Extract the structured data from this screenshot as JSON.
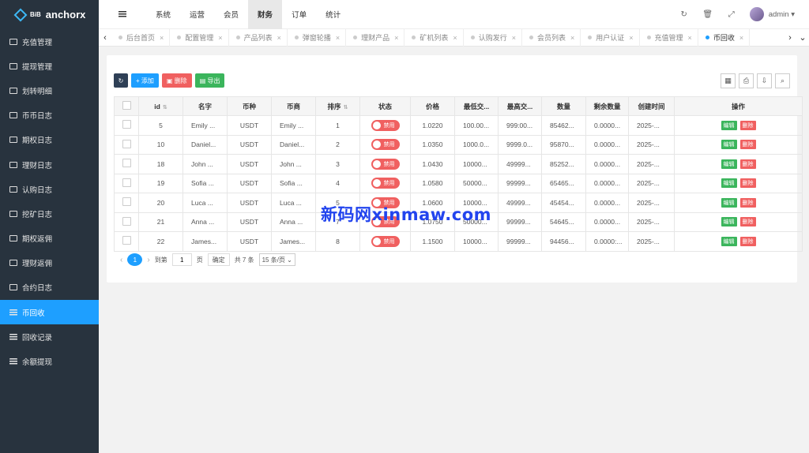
{
  "brand": {
    "badge": "BiB",
    "name": "anchorx"
  },
  "sidebar": {
    "items": [
      {
        "label": "充值管理",
        "icon": "card-icon"
      },
      {
        "label": "提现管理",
        "icon": "card-icon"
      },
      {
        "label": "划转明细",
        "icon": "card-icon"
      },
      {
        "label": "币币日志",
        "icon": "card-icon"
      },
      {
        "label": "期权日志",
        "icon": "card-icon"
      },
      {
        "label": "理财日志",
        "icon": "card-icon"
      },
      {
        "label": "认购日志",
        "icon": "card-icon"
      },
      {
        "label": "挖矿日志",
        "icon": "card-icon"
      },
      {
        "label": "期权返佣",
        "icon": "card-icon"
      },
      {
        "label": "理财返佣",
        "icon": "card-icon"
      },
      {
        "label": "合约日志",
        "icon": "card-icon"
      },
      {
        "label": "币回收",
        "icon": "list-icon",
        "active": true
      },
      {
        "label": "回收记录",
        "icon": "list-icon"
      },
      {
        "label": "余额提现",
        "icon": "list-icon"
      }
    ]
  },
  "topnav": {
    "items": [
      "系统",
      "运营",
      "会员",
      "财务",
      "订单",
      "统计"
    ],
    "active": "财务"
  },
  "header": {
    "user": "admin ▾"
  },
  "tabs": {
    "items": [
      "后台首页",
      "配置管理",
      "产品列表",
      "弹窗轮播",
      "理财产品",
      "矿机列表",
      "认购发行",
      "会员列表",
      "用户认证",
      "充值管理",
      "币回收"
    ],
    "active": "币回收"
  },
  "toolbar": {
    "add": "+ 添加",
    "delete": "删除",
    "export": "导出"
  },
  "table": {
    "headers": [
      "id",
      "名字",
      "币种",
      "币商",
      "排序",
      "状态",
      "价格",
      "最低交...",
      "最高交...",
      "数量",
      "剩余数量",
      "创建时间",
      "操作"
    ],
    "status_label": "禁用",
    "edit_label": "编辑",
    "delete_label": "删除",
    "rows": [
      {
        "id": "5",
        "name": "Emily ...",
        "coin": "USDT",
        "merchant": "Emily ...",
        "sort": "1",
        "price": "1.0220",
        "min": "100.00...",
        "max": "999:00...",
        "qty": "85462...",
        "remain": "0.0000...",
        "created": "2025-..."
      },
      {
        "id": "10",
        "name": "Daniel...",
        "coin": "USDT",
        "merchant": "Daniel...",
        "sort": "2",
        "price": "1.0350",
        "min": "1000.0...",
        "max": "9999.0...",
        "qty": "95870...",
        "remain": "0.0000...",
        "created": "2025-..."
      },
      {
        "id": "18",
        "name": "John ...",
        "coin": "USDT",
        "merchant": "John ...",
        "sort": "3",
        "price": "1.0430",
        "min": "10000...",
        "max": "49999...",
        "qty": "85252...",
        "remain": "0.0000...",
        "created": "2025-..."
      },
      {
        "id": "19",
        "name": "Sofia ...",
        "coin": "USDT",
        "merchant": "Sofia ...",
        "sort": "4",
        "price": "1.0580",
        "min": "50000...",
        "max": "99999...",
        "qty": "65465...",
        "remain": "0.0000...",
        "created": "2025-..."
      },
      {
        "id": "20",
        "name": "Luca ...",
        "coin": "USDT",
        "merchant": "Luca ...",
        "sort": "5",
        "price": "1.0600",
        "min": "10000...",
        "max": "49999...",
        "qty": "45454...",
        "remain": "0.0000...",
        "created": "2025-..."
      },
      {
        "id": "21",
        "name": "Anna ...",
        "coin": "USDT",
        "merchant": "Anna ...",
        "sort": "7",
        "price": "1.0750",
        "min": "50000...",
        "max": "99999...",
        "qty": "54645...",
        "remain": "0.0000...",
        "created": "2025-..."
      },
      {
        "id": "22",
        "name": "James...",
        "coin": "USDT",
        "merchant": "James...",
        "sort": "8",
        "price": "1.1500",
        "min": "10000...",
        "max": "99999...",
        "qty": "94456...",
        "remain": "0.0000:...",
        "created": "2025-..."
      }
    ]
  },
  "pager": {
    "current": "1",
    "goto_prefix": "到第",
    "goto_value": "1",
    "goto_suffix": "页",
    "confirm": "确定",
    "total": "共 7 条",
    "page_size": "15 条/页"
  },
  "watermark": "新码网xinmaw.com"
}
